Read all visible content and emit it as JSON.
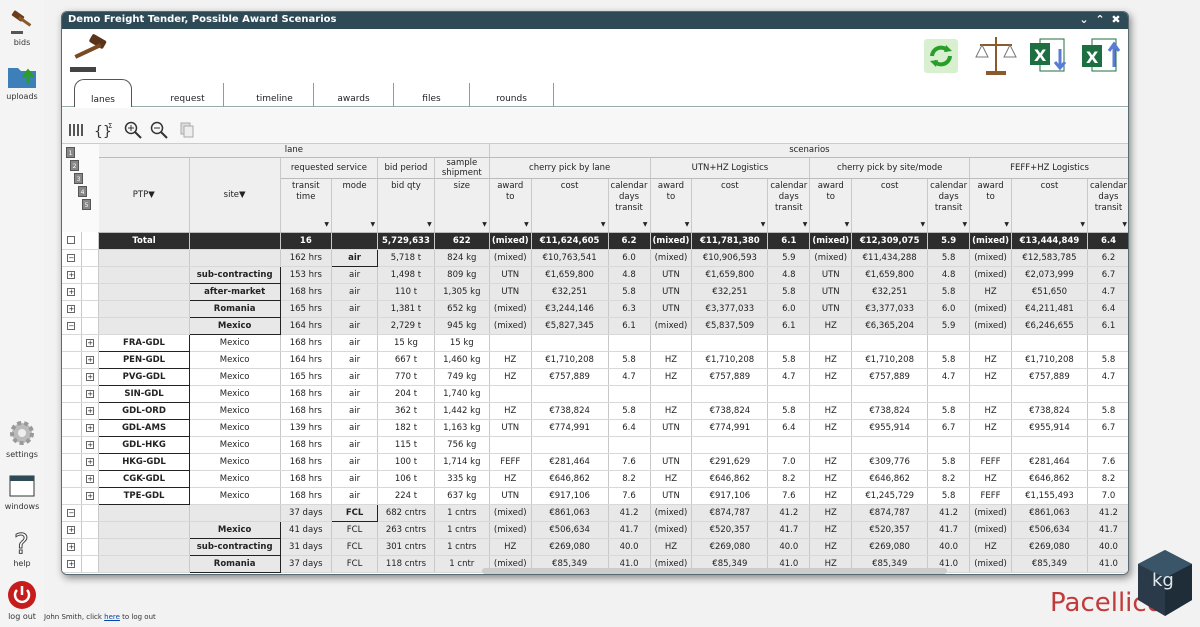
{
  "dock": [
    {
      "label": "bids"
    },
    {
      "label": "uploads"
    },
    {
      "label": "settings"
    },
    {
      "label": "windows"
    },
    {
      "label": "help"
    },
    {
      "label": "log out"
    }
  ],
  "window": {
    "title": "Demo Freight Tender, Possible Award Scenarios",
    "buttons": [
      "v",
      "^",
      "x"
    ]
  },
  "tabs": [
    {
      "label": "lanes",
      "active": true
    },
    {
      "label": "request"
    },
    {
      "label": "timeline"
    },
    {
      "label": "awards"
    },
    {
      "label": "files"
    },
    {
      "label": "rounds"
    }
  ],
  "status": {
    "prefix": "John Smith, click ",
    "link": "here",
    "suffix": " to log out"
  },
  "brand": {
    "name": "Pacellico",
    "mark": "kg"
  },
  "levels": [
    "1",
    "2",
    "3",
    "4",
    "5"
  ],
  "headers": {
    "lane": "lane",
    "scenarios": "scenarios",
    "ptp": "PTP",
    "site": "site",
    "requested_service": "requested service",
    "bid_period": "bid period",
    "sample_shipment": "sample shipment",
    "transit_time": "transit time",
    "mode": "mode",
    "bid_qty": "bid qty",
    "size": "size",
    "scenario_names": [
      "cherry pick by lane",
      "UTN+HZ Logistics",
      "cherry pick by site/mode",
      "FEFF+HZ Logistics"
    ],
    "award_to": "award to",
    "cost": "cost",
    "calendar_days": "calendar days transit"
  },
  "rows": [
    {
      "type": "total",
      "exp": "−",
      "ptp": "Total",
      "site": "",
      "tt": "16",
      "mode": "",
      "qty": "5,729,633",
      "size": "622",
      "s": [
        [
          "(mixed)",
          "€11,624,605",
          "6.2"
        ],
        [
          "(mixed)",
          "€11,781,380",
          "6.1"
        ],
        [
          "(mixed)",
          "€12,309,075",
          "5.9"
        ],
        [
          "(mixed)",
          "€13,444,849",
          "6.4"
        ]
      ]
    },
    {
      "type": "grp1",
      "exp": "−",
      "ptp": "",
      "site": "",
      "tt": "162 hrs",
      "mode": "air",
      "modebox": true,
      "qty": "5,718 t",
      "size": "824 kg",
      "s": [
        [
          "(mixed)",
          "€10,763,541",
          "6.0"
        ],
        [
          "(mixed)",
          "€10,906,593",
          "5.9"
        ],
        [
          "(mixed)",
          "€11,434,288",
          "5.8"
        ],
        [
          "(mixed)",
          "€12,583,785",
          "6.2"
        ]
      ]
    },
    {
      "type": "grp2",
      "exp": "+",
      "ptp": "",
      "site": "sub-contracting",
      "tt": "153 hrs",
      "mode": "air",
      "qty": "1,498 t",
      "size": "809 kg",
      "s": [
        [
          "UTN",
          "€1,659,800",
          "4.8"
        ],
        [
          "UTN",
          "€1,659,800",
          "4.8"
        ],
        [
          "UTN",
          "€1,659,800",
          "4.8"
        ],
        [
          "(mixed)",
          "€2,073,999",
          "6.7"
        ]
      ]
    },
    {
      "type": "grp2",
      "exp": "+",
      "ptp": "",
      "site": "after-market",
      "tt": "168 hrs",
      "mode": "air",
      "qty": "110 t",
      "size": "1,305 kg",
      "s": [
        [
          "UTN",
          "€32,251",
          "5.8"
        ],
        [
          "UTN",
          "€32,251",
          "5.8"
        ],
        [
          "UTN",
          "€32,251",
          "5.8"
        ],
        [
          "HZ",
          "€51,650",
          "4.7"
        ]
      ]
    },
    {
      "type": "grp2",
      "exp": "+",
      "ptp": "",
      "site": "Romania",
      "tt": "165 hrs",
      "mode": "air",
      "qty": "1,381 t",
      "size": "652 kg",
      "hl": true,
      "s": [
        [
          "(mixed)",
          "€3,244,146",
          "6.3"
        ],
        [
          "UTN",
          "€3,377,033",
          "6.0"
        ],
        [
          "UTN",
          "€3,377,033",
          "6.0"
        ],
        [
          "(mixed)",
          "€4,211,481",
          "6.4"
        ]
      ]
    },
    {
      "type": "grp2",
      "exp": "−",
      "ptp": "",
      "site": "Mexico",
      "tt": "164 hrs",
      "mode": "air",
      "qty": "2,729 t",
      "size": "945 kg",
      "s": [
        [
          "(mixed)",
          "€5,827,345",
          "6.1"
        ],
        [
          "(mixed)",
          "€5,837,509",
          "6.1"
        ],
        [
          "HZ",
          "€6,365,204",
          "5.9"
        ],
        [
          "(mixed)",
          "€6,246,655",
          "6.1"
        ]
      ]
    },
    {
      "type": "lane",
      "exp": "+",
      "ptp": "FRA-GDL",
      "site": "Mexico",
      "tt": "168 hrs",
      "mode": "air",
      "qty": "15 kg",
      "size": "15 kg",
      "s": [
        [
          "",
          "",
          ""
        ],
        [
          "",
          "",
          ""
        ],
        [
          "",
          "",
          ""
        ],
        [
          "",
          "",
          ""
        ]
      ]
    },
    {
      "type": "lane",
      "exp": "+",
      "ptp": "PEN-GDL",
      "site": "Mexico",
      "tt": "164 hrs",
      "mode": "air",
      "qty": "667 t",
      "size": "1,460 kg",
      "s": [
        [
          "HZ",
          "€1,710,208",
          "5.8"
        ],
        [
          "HZ",
          "€1,710,208",
          "5.8"
        ],
        [
          "HZ",
          "€1,710,208",
          "5.8"
        ],
        [
          "HZ",
          "€1,710,208",
          "5.8"
        ]
      ]
    },
    {
      "type": "lane",
      "exp": "+",
      "ptp": "PVG-GDL",
      "site": "Mexico",
      "tt": "165 hrs",
      "mode": "air",
      "qty": "770 t",
      "size": "749 kg",
      "s": [
        [
          "HZ",
          "€757,889",
          "4.7"
        ],
        [
          "HZ",
          "€757,889",
          "4.7"
        ],
        [
          "HZ",
          "€757,889",
          "4.7"
        ],
        [
          "HZ",
          "€757,889",
          "4.7"
        ]
      ]
    },
    {
      "type": "lane",
      "exp": "+",
      "ptp": "SIN-GDL",
      "site": "Mexico",
      "tt": "168 hrs",
      "mode": "air",
      "qty": "204 t",
      "size": "1,740 kg",
      "s": [
        [
          "",
          "",
          ""
        ],
        [
          "",
          "",
          ""
        ],
        [
          "",
          "",
          ""
        ],
        [
          "",
          "",
          ""
        ]
      ]
    },
    {
      "type": "lane",
      "exp": "+",
      "ptp": "GDL-ORD",
      "site": "Mexico",
      "tt": "168 hrs",
      "mode": "air",
      "qty": "362 t",
      "size": "1,442 kg",
      "s": [
        [
          "HZ",
          "€738,824",
          "5.8"
        ],
        [
          "HZ",
          "€738,824",
          "5.8"
        ],
        [
          "HZ",
          "€738,824",
          "5.8"
        ],
        [
          "HZ",
          "€738,824",
          "5.8"
        ]
      ]
    },
    {
      "type": "lane",
      "exp": "+",
      "ptp": "GDL-AMS",
      "site": "Mexico",
      "tt": "139 hrs",
      "mode": "air",
      "qty": "182 t",
      "size": "1,163 kg",
      "s": [
        [
          "UTN",
          "€774,991",
          "6.4"
        ],
        [
          "UTN",
          "€774,991",
          "6.4"
        ],
        [
          "HZ",
          "€955,914",
          "6.7"
        ],
        [
          "HZ",
          "€955,914",
          "6.7"
        ]
      ]
    },
    {
      "type": "lane",
      "exp": "+",
      "ptp": "GDL-HKG",
      "site": "Mexico",
      "tt": "168 hrs",
      "mode": "air",
      "qty": "115 t",
      "size": "756 kg",
      "s": [
        [
          "",
          "",
          ""
        ],
        [
          "",
          "",
          ""
        ],
        [
          "",
          "",
          ""
        ],
        [
          "",
          "",
          ""
        ]
      ]
    },
    {
      "type": "lane",
      "exp": "+",
      "ptp": "HKG-GDL",
      "site": "Mexico",
      "tt": "168 hrs",
      "mode": "air",
      "qty": "100 t",
      "size": "1,714 kg",
      "s": [
        [
          "FEFF",
          "€281,464",
          "7.6"
        ],
        [
          "UTN",
          "€291,629",
          "7.0"
        ],
        [
          "HZ",
          "€309,776",
          "5.8"
        ],
        [
          "FEFF",
          "€281,464",
          "7.6"
        ]
      ]
    },
    {
      "type": "lane",
      "exp": "+",
      "ptp": "CGK-GDL",
      "site": "Mexico",
      "tt": "168 hrs",
      "mode": "air",
      "qty": "106 t",
      "size": "335 kg",
      "s": [
        [
          "HZ",
          "€646,862",
          "8.2"
        ],
        [
          "HZ",
          "€646,862",
          "8.2"
        ],
        [
          "HZ",
          "€646,862",
          "8.2"
        ],
        [
          "HZ",
          "€646,862",
          "8.2"
        ]
      ]
    },
    {
      "type": "lane",
      "exp": "+",
      "ptp": "TPE-GDL",
      "site": "Mexico",
      "tt": "168 hrs",
      "mode": "air",
      "qty": "224 t",
      "size": "637 kg",
      "s": [
        [
          "UTN",
          "€917,106",
          "7.6"
        ],
        [
          "UTN",
          "€917,106",
          "7.6"
        ],
        [
          "HZ",
          "€1,245,729",
          "5.8"
        ],
        [
          "FEFF",
          "€1,155,493",
          "7.0"
        ]
      ]
    },
    {
      "type": "grp1",
      "exp": "−",
      "ptp": "",
      "site": "",
      "tt": "37 days",
      "mode": "FCL",
      "modebox": true,
      "qty": "682 cntrs",
      "size": "1 cntrs",
      "s": [
        [
          "(mixed)",
          "€861,063",
          "41.2"
        ],
        [
          "(mixed)",
          "€874,787",
          "41.2"
        ],
        [
          "HZ",
          "€874,787",
          "41.2"
        ],
        [
          "(mixed)",
          "€861,063",
          "41.2"
        ]
      ]
    },
    {
      "type": "grp2",
      "exp": "+",
      "ptp": "",
      "site": "Mexico",
      "tt": "41 days",
      "mode": "FCL",
      "qty": "263 cntrs",
      "size": "1 cntrs",
      "s": [
        [
          "(mixed)",
          "€506,634",
          "41.7"
        ],
        [
          "(mixed)",
          "€520,357",
          "41.7"
        ],
        [
          "HZ",
          "€520,357",
          "41.7"
        ],
        [
          "(mixed)",
          "€506,634",
          "41.7"
        ]
      ]
    },
    {
      "type": "grp2",
      "exp": "+",
      "ptp": "",
      "site": "sub-contracting",
      "tt": "31 days",
      "mode": "FCL",
      "qty": "301 cntrs",
      "size": "1 cntrs",
      "s": [
        [
          "HZ",
          "€269,080",
          "40.0"
        ],
        [
          "HZ",
          "€269,080",
          "40.0"
        ],
        [
          "HZ",
          "€269,080",
          "40.0"
        ],
        [
          "HZ",
          "€269,080",
          "40.0"
        ]
      ]
    },
    {
      "type": "grp2",
      "exp": "+",
      "ptp": "",
      "site": "Romania",
      "tt": "37 days",
      "mode": "FCL",
      "qty": "118 cntrs",
      "size": "1 cntr",
      "s": [
        [
          "(mixed)",
          "€85,349",
          "41.0"
        ],
        [
          "(mixed)",
          "€85,349",
          "41.0"
        ],
        [
          "HZ",
          "€85,349",
          "41.0"
        ],
        [
          "(mixed)",
          "€85,349",
          "41.0"
        ]
      ]
    }
  ]
}
